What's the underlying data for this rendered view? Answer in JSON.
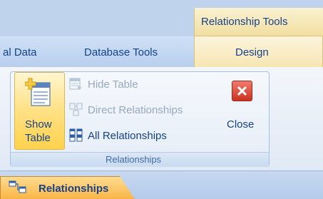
{
  "contextual_tab_group": {
    "label": "Relationship Tools"
  },
  "tabs": [
    {
      "label": "al Data"
    },
    {
      "label": "Database Tools"
    },
    {
      "label": "Design",
      "active": true
    }
  ],
  "ribbon": {
    "group_label": "Relationships",
    "show_table": {
      "label_line1": "Show",
      "label_line2": "Table",
      "icon": "show-table-icon"
    },
    "commands": [
      {
        "label": "Hide Table",
        "enabled": false,
        "icon": "hide-table-icon"
      },
      {
        "label": "Direct Relationships",
        "enabled": false,
        "icon": "direct-relationships-icon"
      },
      {
        "label": "All Relationships",
        "enabled": true,
        "icon": "all-relationships-icon"
      }
    ],
    "close": {
      "label": "Close",
      "icon": "close-icon"
    }
  },
  "object_tab": {
    "label": "Relationships",
    "icon": "relationships-icon"
  },
  "colors": {
    "accent_text": "#15428b",
    "disabled_text": "#98a8c0",
    "hover_yellow": "#ffd24d",
    "close_red": "#c9331f",
    "object_tab_orange": "#f9b547"
  }
}
